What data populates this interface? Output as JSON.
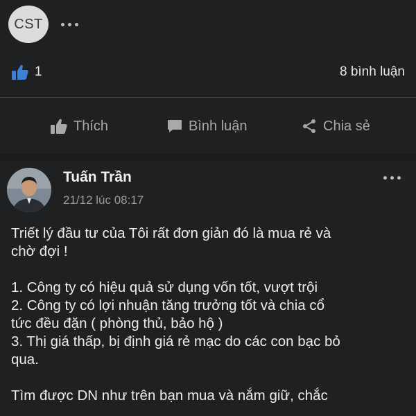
{
  "page": {
    "avatar_label": "CST"
  },
  "reactions": {
    "like_count": "1",
    "comments_label": "8 bình luận"
  },
  "actions": {
    "like": "Thích",
    "comment": "Bình luận",
    "share": "Chia sẻ"
  },
  "post": {
    "author": "Tuấn Trần",
    "time": "21/12 lúc 08:17",
    "lines": [
      "Triết lý đầu tư của Tôi rất đơn giản đó là mua rẻ và",
      "chờ đợi !",
      "",
      "1. Công ty có hiệu quả sử dụng vốn tốt, vượt trội",
      "2. Công ty có lợi nhuận tăng trưởng tốt và chia cổ",
      "tức đều đặn ( phòng thủ, bảo hộ )",
      "3. Thị giá thấp, bị định giá rẻ mạc do các con bạc bỏ",
      "qua.",
      "",
      "Tìm được DN như trên bạn mua và nắm giữ, chắc"
    ]
  },
  "colors": {
    "like_blue": "#3b82d6",
    "background": "#1b1c1e",
    "card": "#1f2022"
  }
}
